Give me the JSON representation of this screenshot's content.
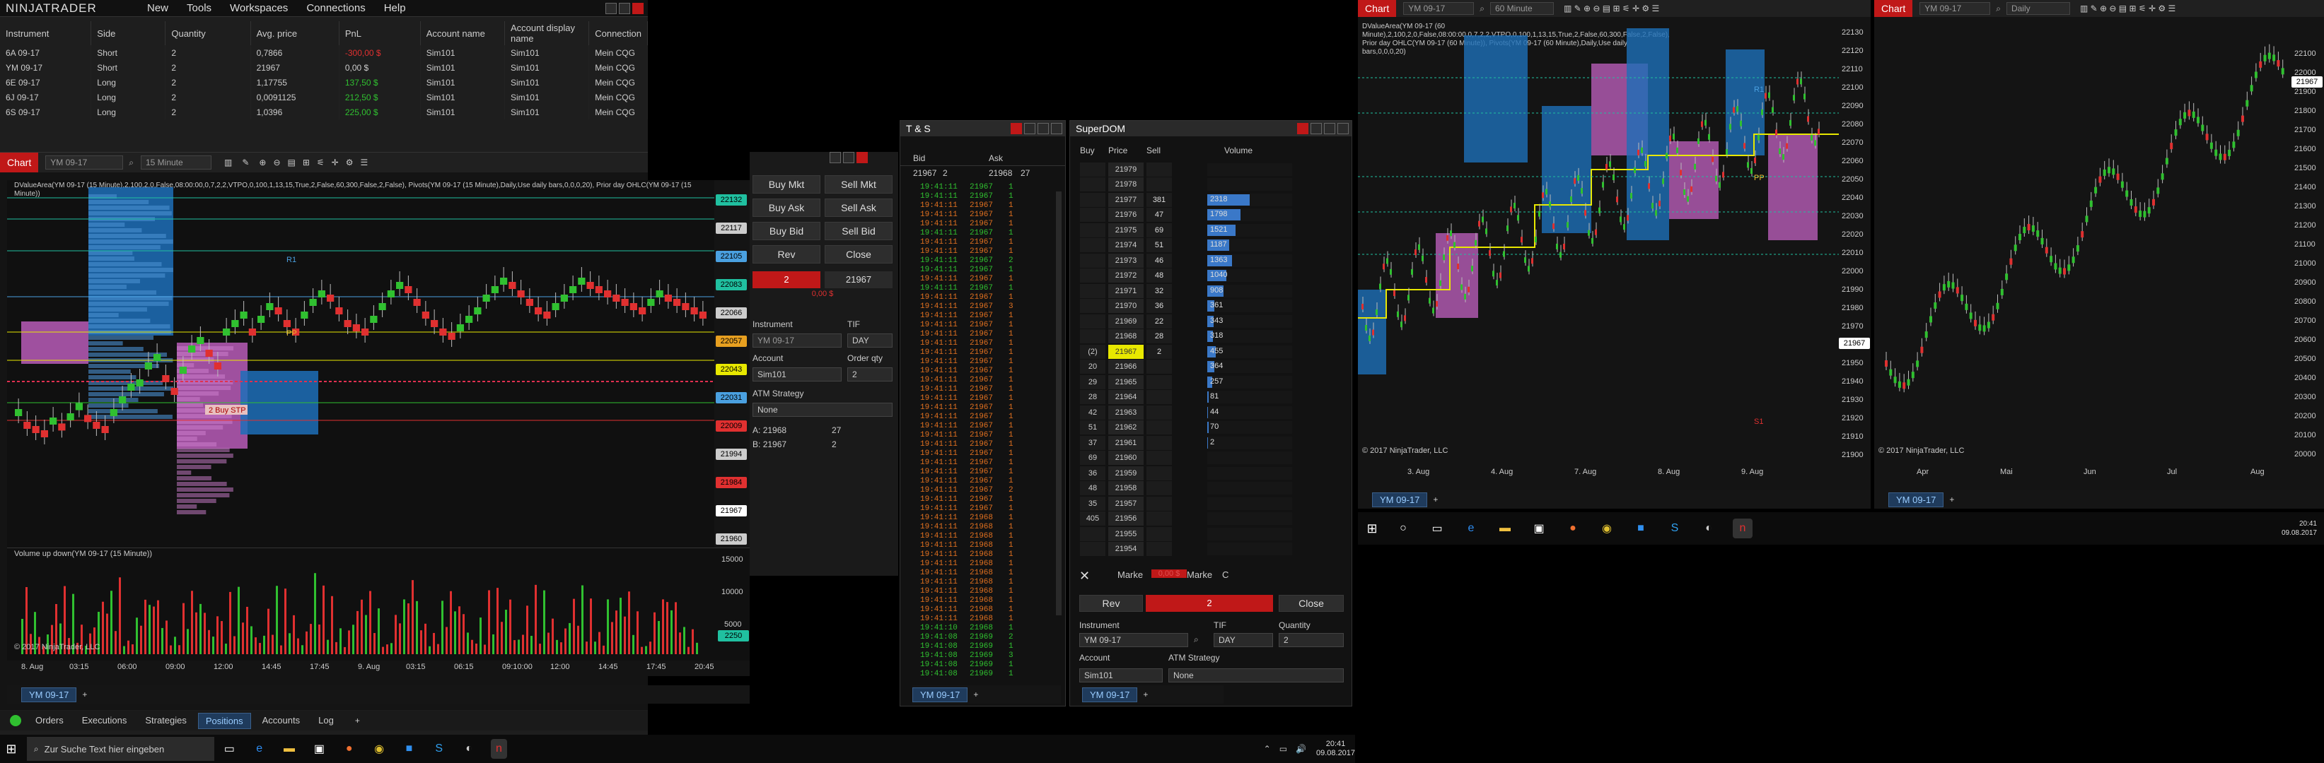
{
  "app": {
    "logo": "NINJATRADER",
    "menu": [
      "New",
      "Tools",
      "Workspaces",
      "Connections",
      "Help"
    ]
  },
  "positions": {
    "columns": [
      "Instrument",
      "Side",
      "Quantity",
      "Avg. price",
      "PnL",
      "Account name",
      "Account display name",
      "Connection"
    ],
    "rows": [
      [
        "6A 09-17",
        "Short",
        "2",
        "0,7866",
        "-300,00 $",
        "Sim101",
        "Sim101",
        "Mein CQG"
      ],
      [
        "YM 09-17",
        "Short",
        "2",
        "21967",
        "0,00 $",
        "Sim101",
        "Sim101",
        "Mein CQG"
      ],
      [
        "6E 09-17",
        "Long",
        "2",
        "1,17755",
        "137,50 $",
        "Sim101",
        "Sim101",
        "Mein CQG"
      ],
      [
        "6J 09-17",
        "Long",
        "2",
        "0,0091125",
        "212,50 $",
        "Sim101",
        "Sim101",
        "Mein CQG"
      ],
      [
        "6S 09-17",
        "Long",
        "2",
        "1,0396",
        "225,00 $",
        "Sim101",
        "Sim101",
        "Mein CQG"
      ]
    ],
    "pnl_colors": [
      "#e03030",
      "#cccccc",
      "#30c030",
      "#30c030",
      "#30c030"
    ]
  },
  "chart_main": {
    "title": "Chart",
    "instrument": "YM 09-17",
    "interval": "15 Minute",
    "indicator_text": "DValueArea(YM 09-17 (15 Minute),2,100,2,0,False,08:00:00,0,7,2,2,VTPO,0,100,1,13,15,True,2,False,60,300,False,2,False), Pivots(YM 09-17 (15 Minute),Daily,Use daily bars,0,0,0,20), Prior day OHLC(YM 09-17 (15 Minute))",
    "price_labels": [
      "22132",
      "22117",
      "22105",
      "22083",
      "22066",
      "22057",
      "22043",
      "22031",
      "22009",
      "21994",
      "21984",
      "21967",
      "21960"
    ],
    "x_ticks": [
      "8. Aug",
      "03:15",
      "06:00",
      "09:00",
      "12:00",
      "14:45",
      "17:45",
      "9. Aug",
      "03:15",
      "06:15",
      "09:10:00",
      "12:00",
      "14:45",
      "17:45",
      "20:45"
    ],
    "order_label": "2  Buy STP",
    "order_price": "0,00 $",
    "order_qty": "2",
    "r1": "R1",
    "pp": "PP",
    "volume_title": "Volume up down(YM 09-17 (15 Minute))",
    "vol_ticks": [
      "15000",
      "10000",
      "5000"
    ],
    "vol_last": "2250",
    "copyright": "© 2017 NinjaTrader, LLC",
    "tab": "YM 09-17",
    "bars": [
      55,
      40,
      35,
      30,
      45,
      38,
      50,
      62,
      48,
      40,
      35,
      55,
      70,
      85,
      90,
      110,
      120,
      95,
      80,
      105,
      130,
      140,
      125,
      110,
      150,
      160,
      170,
      150,
      165,
      180,
      175,
      160,
      150,
      170,
      185,
      195,
      190,
      175,
      160,
      155,
      150,
      165,
      180,
      195,
      205,
      200,
      185,
      170,
      160,
      150,
      145,
      155,
      165,
      175,
      190,
      200,
      210,
      205,
      195,
      185,
      175,
      170,
      180,
      190,
      200,
      210,
      205,
      200,
      195,
      190,
      185,
      180,
      175,
      185,
      195,
      190,
      185,
      180,
      175,
      170
    ]
  },
  "order_panel": {
    "buy_mkt": "Buy Mkt",
    "sell_mkt": "Sell Mkt",
    "buy_ask": "Buy Ask",
    "sell_ask": "Sell Ask",
    "buy_bid": "Buy Bid",
    "sell_bid": "Sell Bid",
    "rev": "Rev",
    "close": "Close",
    "position_qty": "2",
    "position_price": "21967",
    "pnl": "0,00 $",
    "instrument_label": "Instrument",
    "instrument": "YM 09-17",
    "tif_label": "TIF",
    "tif": "DAY",
    "account_label": "Account",
    "account": "Sim101",
    "qty_label": "Order qty",
    "qty": "2",
    "atm_label": "ATM Strategy",
    "atm": "None",
    "a_label": "A:",
    "a_price": "21968",
    "a_size": "27",
    "b_label": "B:",
    "b_price": "21967",
    "b_size": "2"
  },
  "ts": {
    "title": "T & S",
    "headers": [
      "Bid",
      "Ask"
    ],
    "bid": "21967",
    "bid_size": "2",
    "ask": "21968",
    "ask_size": "27",
    "rows": [
      [
        "19:41:11",
        "21967",
        "1",
        "g"
      ],
      [
        "19:41:11",
        "21967",
        "1",
        "g"
      ],
      [
        "19:41:11",
        "21967",
        "1",
        "o"
      ],
      [
        "19:41:11",
        "21967",
        "1",
        "o"
      ],
      [
        "19:41:11",
        "21967",
        "1",
        "o"
      ],
      [
        "19:41:11",
        "21967",
        "1",
        "g"
      ],
      [
        "19:41:11",
        "21967",
        "1",
        "o"
      ],
      [
        "19:41:11",
        "21967",
        "1",
        "o"
      ],
      [
        "19:41:11",
        "21967",
        "2",
        "g"
      ],
      [
        "19:41:11",
        "21967",
        "1",
        "g"
      ],
      [
        "19:41:11",
        "21967",
        "1",
        "o"
      ],
      [
        "19:41:11",
        "21967",
        "1",
        "g"
      ],
      [
        "19:41:11",
        "21967",
        "1",
        "o"
      ],
      [
        "19:41:11",
        "21967",
        "3",
        "o"
      ],
      [
        "19:41:11",
        "21967",
        "1",
        "o"
      ],
      [
        "19:41:11",
        "21967",
        "1",
        "o"
      ],
      [
        "19:41:11",
        "21967",
        "1",
        "o"
      ],
      [
        "19:41:11",
        "21967",
        "1",
        "o"
      ],
      [
        "19:41:11",
        "21967",
        "1",
        "o"
      ],
      [
        "19:41:11",
        "21967",
        "1",
        "o"
      ],
      [
        "19:41:11",
        "21967",
        "1",
        "o"
      ],
      [
        "19:41:11",
        "21967",
        "1",
        "o"
      ],
      [
        "19:41:11",
        "21967",
        "1",
        "o"
      ],
      [
        "19:41:11",
        "21967",
        "1",
        "o"
      ],
      [
        "19:41:11",
        "21967",
        "1",
        "o"
      ],
      [
        "19:41:11",
        "21967",
        "1",
        "o"
      ],
      [
        "19:41:11",
        "21967",
        "1",
        "o"
      ],
      [
        "19:41:11",
        "21967",
        "1",
        "o"
      ],
      [
        "19:41:11",
        "21967",
        "1",
        "o"
      ],
      [
        "19:41:11",
        "21967",
        "1",
        "o"
      ],
      [
        "19:41:11",
        "21967",
        "1",
        "o"
      ],
      [
        "19:41:11",
        "21967",
        "1",
        "o"
      ],
      [
        "19:41:11",
        "21967",
        "1",
        "o"
      ],
      [
        "19:41:11",
        "21967",
        "2",
        "o"
      ],
      [
        "19:41:11",
        "21967",
        "1",
        "o"
      ],
      [
        "19:41:11",
        "21967",
        "1",
        "o"
      ],
      [
        "19:41:11",
        "21968",
        "1",
        "o"
      ],
      [
        "19:41:11",
        "21968",
        "1",
        "o"
      ],
      [
        "19:41:11",
        "21968",
        "1",
        "o"
      ],
      [
        "19:41:11",
        "21968",
        "1",
        "o"
      ],
      [
        "19:41:11",
        "21968",
        "1",
        "o"
      ],
      [
        "19:41:11",
        "21968",
        "1",
        "o"
      ],
      [
        "19:41:11",
        "21968",
        "1",
        "o"
      ],
      [
        "19:41:11",
        "21968",
        "1",
        "o"
      ],
      [
        "19:41:11",
        "21968",
        "1",
        "o"
      ],
      [
        "19:41:11",
        "21968",
        "1",
        "o"
      ],
      [
        "19:41:11",
        "21968",
        "1",
        "o"
      ],
      [
        "19:41:11",
        "21968",
        "1",
        "o"
      ],
      [
        "19:41:10",
        "21968",
        "1",
        "g"
      ],
      [
        "19:41:08",
        "21969",
        "2",
        "g"
      ],
      [
        "19:41:08",
        "21969",
        "1",
        "g"
      ],
      [
        "19:41:08",
        "21969",
        "3",
        "g"
      ],
      [
        "19:41:08",
        "21969",
        "1",
        "g"
      ],
      [
        "19:41:08",
        "21969",
        "1",
        "g"
      ]
    ],
    "tab": "YM 09-17"
  },
  "dom": {
    "title": "SuperDOM",
    "headers": [
      "Buy",
      "Price",
      "Sell",
      "Volume"
    ],
    "rows": [
      [
        "",
        "21979",
        "",
        ""
      ],
      [
        "",
        "21978",
        "",
        ""
      ],
      [
        "",
        "21977",
        "381",
        "2318"
      ],
      [
        "",
        "21976",
        "47",
        "1798"
      ],
      [
        "",
        "21975",
        "69",
        "1521"
      ],
      [
        "",
        "21974",
        "51",
        "1187"
      ],
      [
        "",
        "21973",
        "46",
        "1363"
      ],
      [
        "",
        "21972",
        "48",
        "1040"
      ],
      [
        "",
        "21971",
        "32",
        "908"
      ],
      [
        "",
        "21970",
        "36",
        "361"
      ],
      [
        "",
        "21969",
        "22",
        "343"
      ],
      [
        "",
        "21968",
        "28",
        "318"
      ],
      [
        "(2)",
        "21967",
        "2",
        "455"
      ],
      [
        "20",
        "21966",
        "",
        "364"
      ],
      [
        "29",
        "21965",
        "",
        "257"
      ],
      [
        "28",
        "21964",
        "",
        "81"
      ],
      [
        "42",
        "21963",
        "",
        "44"
      ],
      [
        "51",
        "21962",
        "",
        "70"
      ],
      [
        "37",
        "21961",
        "",
        "2"
      ],
      [
        "69",
        "21960",
        "",
        ""
      ],
      [
        "36",
        "21959",
        "",
        ""
      ],
      [
        "48",
        "21958",
        "",
        ""
      ],
      [
        "35",
        "21957",
        "",
        ""
      ],
      [
        "405",
        "21956",
        "",
        ""
      ],
      [
        "",
        "21955",
        "",
        ""
      ],
      [
        "",
        "21954",
        "",
        ""
      ]
    ],
    "vol_scale": [
      1.0,
      0.78,
      0.66,
      0.51,
      0.59,
      0.45,
      0.39,
      0.16,
      0.15,
      0.14,
      0.2,
      0.16,
      0.11,
      0.035,
      0.02,
      0.03,
      0.001
    ],
    "market_left": "Marke",
    "pnl": "0,00 $",
    "market_right": "Marke",
    "c": "C",
    "rev": "Rev",
    "qty": "2",
    "close": "Close",
    "instrument_label": "Instrument",
    "instrument": "YM 09-17",
    "tif_label": "TIF",
    "tif": "DAY",
    "quantity_label": "Quantity",
    "quantity": "2",
    "account_label": "Account",
    "account": "Sim101",
    "atm_label": "ATM Strategy",
    "atm": "None",
    "tab": "YM 09-17"
  },
  "chart60": {
    "title": "Chart",
    "instrument": "YM 09-17",
    "interval": "60 Minute",
    "indicator_text": "DValueArea(YM 09-17 (60 Minute),2,100,2,0,False,08:00:00,0,7,2,2,VTPO,0,100,1,13,15,True,2,False,60,300,False,2,False), Prior day OHLC(YM 09-17 (60 Minute)), Pivots(YM 09-17 (60 Minute),Daily,Use daily bars,0,0,0,20)",
    "y_ticks": [
      "22130",
      "22120",
      "22110",
      "22100",
      "22090",
      "22080",
      "22070",
      "22060",
      "22050",
      "22040",
      "22030",
      "22020",
      "22010",
      "22000",
      "21990",
      "21980",
      "21970",
      "21960",
      "21950",
      "21940",
      "21930",
      "21920",
      "21910",
      "21900"
    ],
    "last": "21967",
    "x_ticks": [
      "3. Aug",
      "4. Aug",
      "7. Aug",
      "8. Aug",
      "9. Aug"
    ],
    "r1": "R1",
    "pp": "PP",
    "s1": "S1",
    "copyright": "© 2017 NinjaTrader, LLC",
    "tab": "YM 09-17"
  },
  "chartDaily": {
    "title": "Chart",
    "instrument": "YM 09-17",
    "interval": "Daily",
    "y_ticks": [
      "22100",
      "22000",
      "21900",
      "21800",
      "21700",
      "21600",
      "21500",
      "21400",
      "21300",
      "21200",
      "21100",
      "21000",
      "20900",
      "20800",
      "20700",
      "20600",
      "20500",
      "20400",
      "20300",
      "20200",
      "20100",
      "20000"
    ],
    "last": "21967",
    "x_ticks": [
      "Apr",
      "Mai",
      "Jun",
      "Jul",
      "Aug"
    ],
    "copyright": "© 2017 NinjaTrader, LLC",
    "tab": "YM 09-17"
  },
  "bottom_tabs": [
    "Orders",
    "Executions",
    "Strategies",
    "Positions",
    "Accounts",
    "Log"
  ],
  "taskbar": {
    "search_placeholder": "Zur Suche Text hier eingeben",
    "time": "20:41",
    "date": "09.08.2017",
    "time2": "20:41",
    "date2": "09.08.2017"
  },
  "colors": {
    "accent_red": "#c01818",
    "up": "#30c030",
    "down": "#e03030",
    "va_blue": "#1d6fb8",
    "va_magenta": "#b85cb8",
    "yellow": "#e8e800"
  }
}
